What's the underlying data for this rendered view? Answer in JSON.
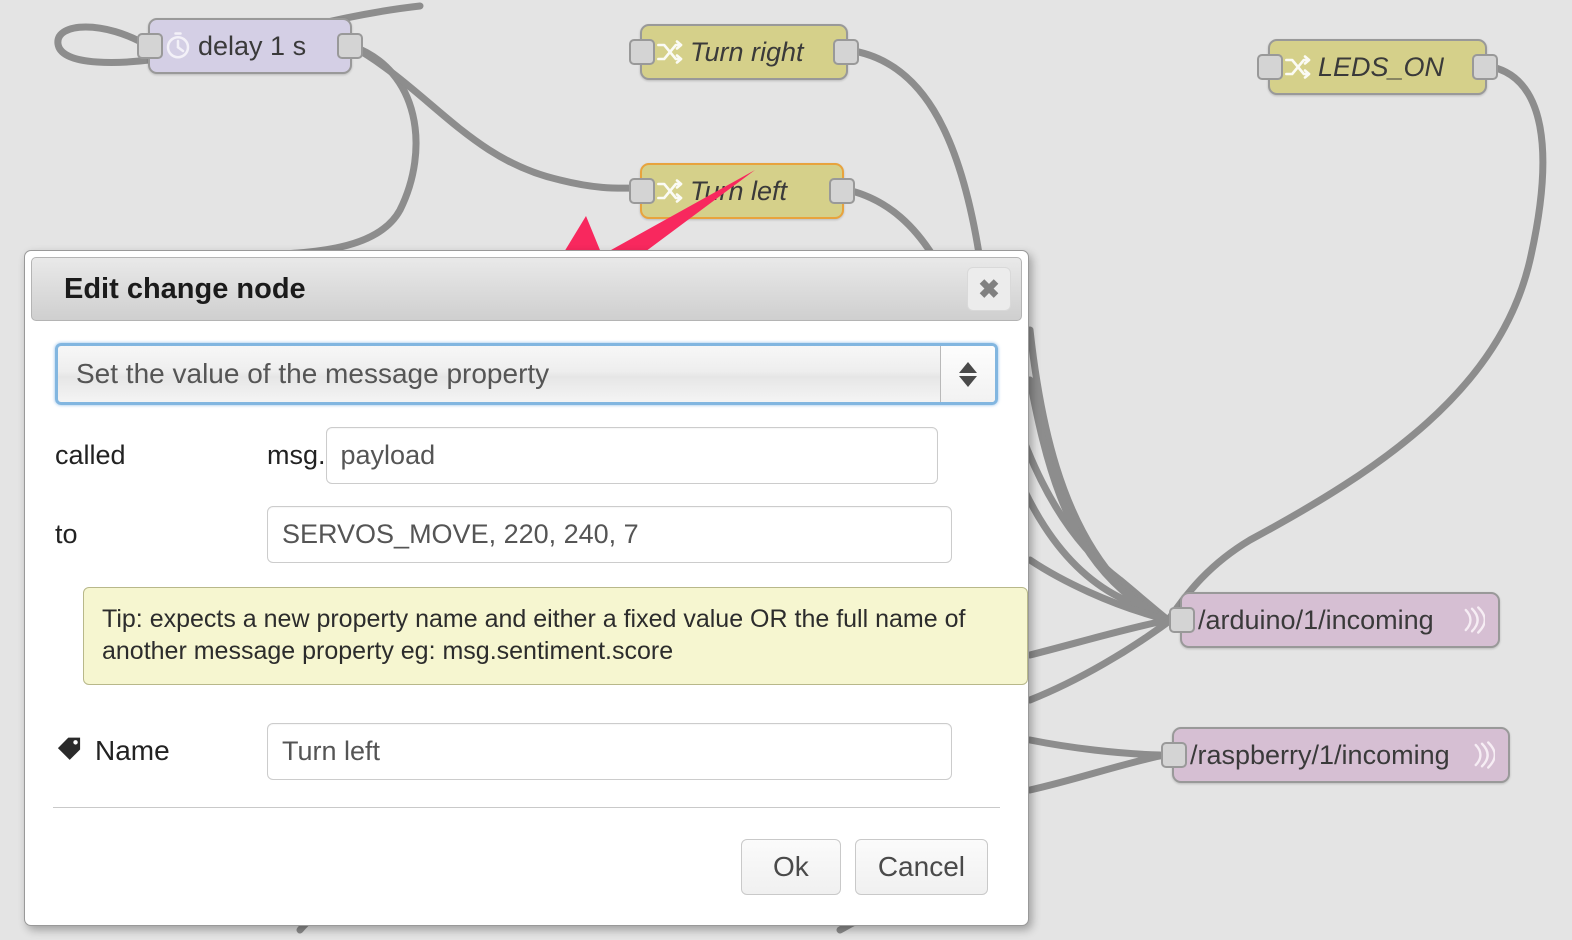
{
  "canvas": {
    "background_color": "#e4e4e4",
    "wire_color": "#8d8d8d",
    "nodes": [
      {
        "id": "delay",
        "label": "delay 1 s",
        "type": "delay",
        "icon": "timer-icon",
        "color": "#d4cfe5",
        "selected": false,
        "italic": false
      },
      {
        "id": "turn-right",
        "label": "Turn right",
        "type": "change",
        "icon": "shuffle-icon",
        "color": "#d5d08a",
        "selected": false,
        "italic": true
      },
      {
        "id": "turn-left",
        "label": "Turn left",
        "type": "change",
        "icon": "shuffle-icon",
        "color": "#d5d08a",
        "selected": true,
        "italic": true
      },
      {
        "id": "leds-on",
        "label": "LEDS_ON",
        "type": "change",
        "icon": "shuffle-icon",
        "color": "#d5d08a",
        "selected": false,
        "italic": true
      },
      {
        "id": "arduino-mqtt",
        "label": "/arduino/1/incoming",
        "type": "mqtt-out",
        "icon": "broadcast-icon",
        "color": "#d6bfd3",
        "selected": false,
        "italic": false
      },
      {
        "id": "raspberry-mqtt",
        "label": "/raspberry/1/incoming",
        "type": "mqtt-out",
        "icon": "broadcast-icon",
        "color": "#d6bfd3",
        "selected": false,
        "italic": false
      }
    ]
  },
  "annotation": {
    "arrow_color": "#f8285e",
    "name": "pink-callout-arrow",
    "points_to": "Edit change node dialog header"
  },
  "dialog": {
    "title": "Edit change node",
    "close_label": "✖",
    "rule_select": {
      "selected": "Set the value of the message property",
      "options": [
        "Set the value of the message property"
      ]
    },
    "called_label": "called",
    "msg_prefix": "msg.",
    "property_value": "payload",
    "property_placeholder": "payload",
    "to_label": "to",
    "to_value": "SERVOS_MOVE, 220, 240, 7",
    "to_placeholder": "",
    "tip_text": "Tip: expects a new property name and either a fixed value OR the full name of another message property eg: msg.sentiment.score",
    "name_label": "Name",
    "name_value": "Turn left",
    "name_placeholder": "Name",
    "ok_label": "Ok",
    "cancel_label": "Cancel"
  }
}
